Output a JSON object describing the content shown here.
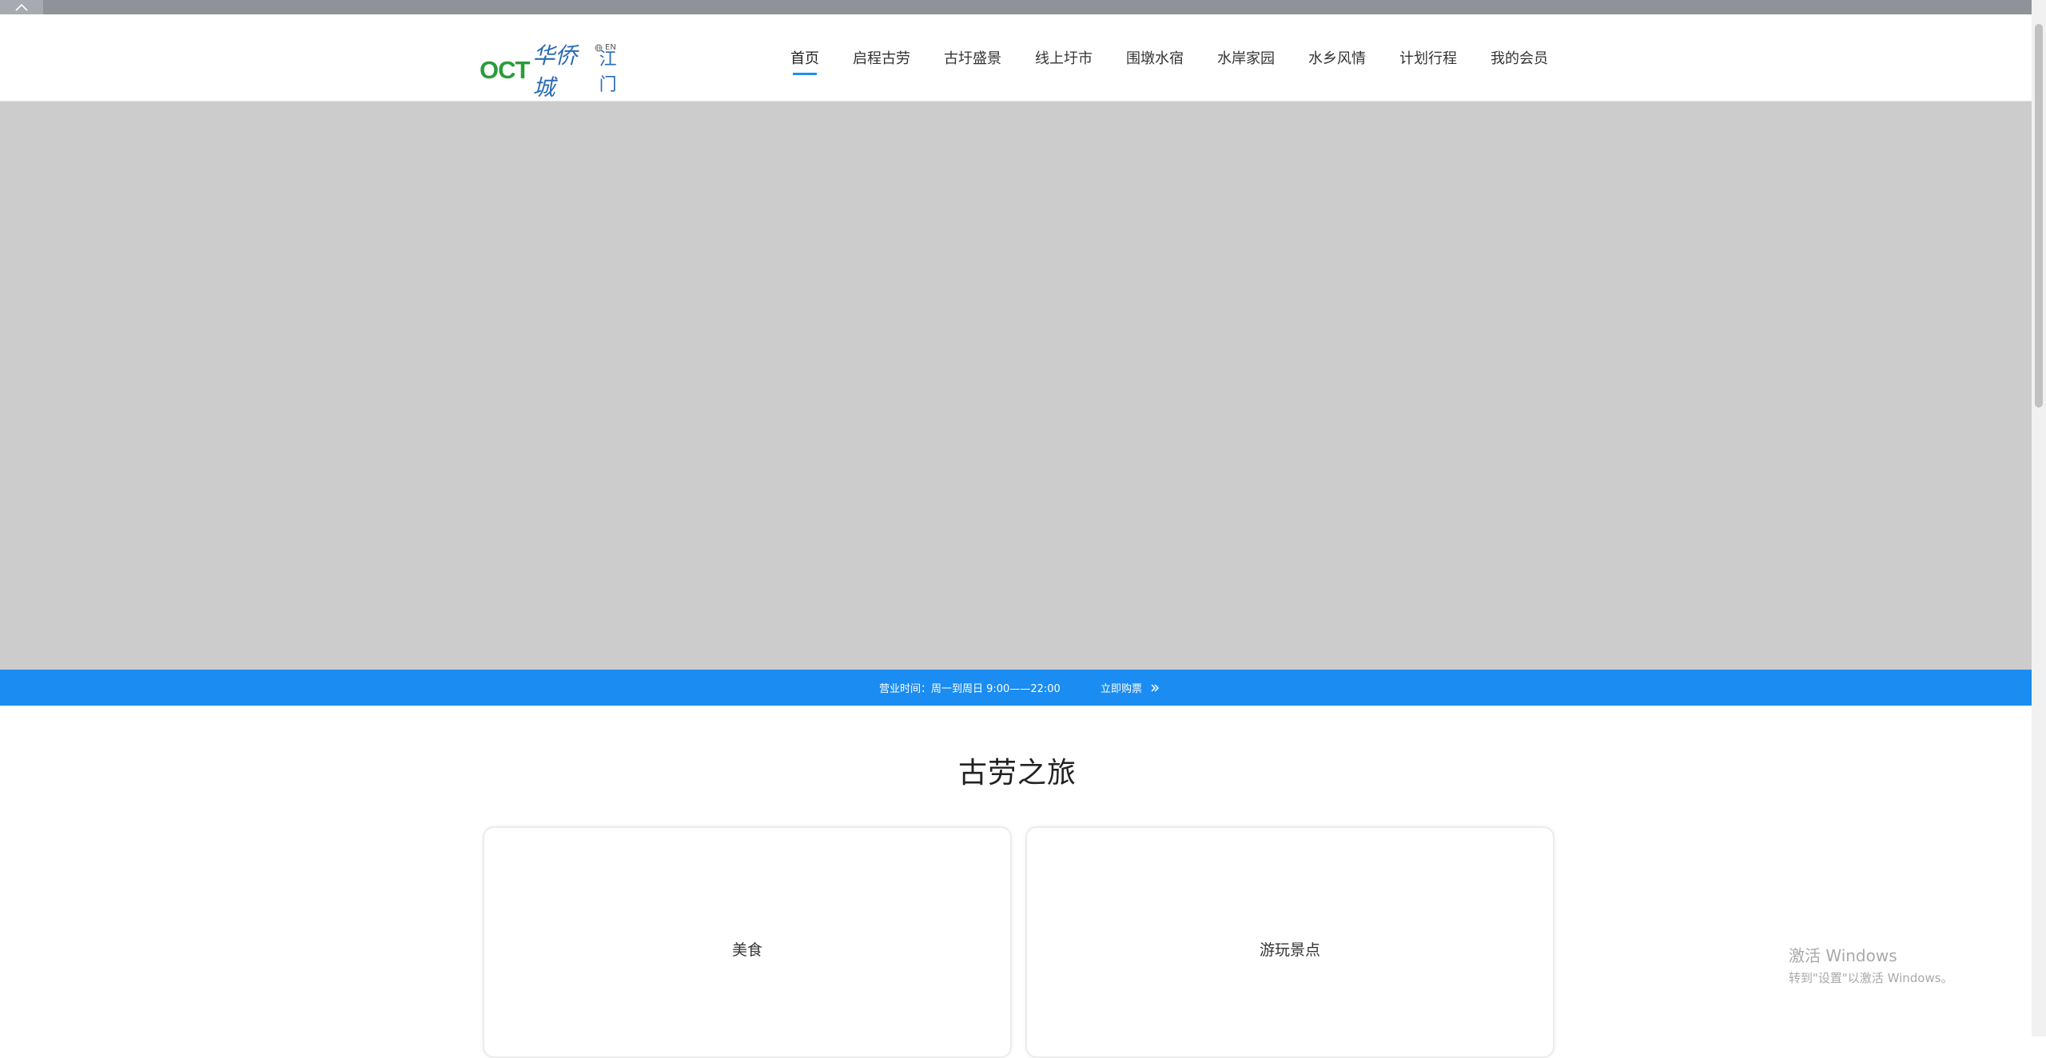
{
  "header": {
    "logo": {
      "brand": "OCT",
      "cn_name": "华侨城",
      "city": "江门"
    },
    "lang_label": "EN",
    "nav": [
      {
        "label": "首页",
        "active": true
      },
      {
        "label": "启程古劳"
      },
      {
        "label": "古圩盛景"
      },
      {
        "label": "线上圩市"
      },
      {
        "label": "围墩水宿"
      },
      {
        "label": "水岸家园"
      },
      {
        "label": "水乡风情"
      },
      {
        "label": "计划行程"
      },
      {
        "label": "我的会员"
      }
    ]
  },
  "infobar": {
    "hours": "营业时间：周一到周日  9:00——22:00",
    "buy_label": "立即购票",
    "color": "#1b8cf2"
  },
  "section": {
    "title": "古劳之旅",
    "cards": [
      {
        "label": "美食"
      },
      {
        "label": "游玩景点"
      }
    ]
  },
  "watermark": {
    "line1": "激活 Windows",
    "line2": "转到\"设置\"以激活 Windows。"
  },
  "icons": {
    "back_to_top": "chevron-up-icon",
    "language": "globe-icon",
    "buy_arrow": "double-chevron-right-icon"
  }
}
